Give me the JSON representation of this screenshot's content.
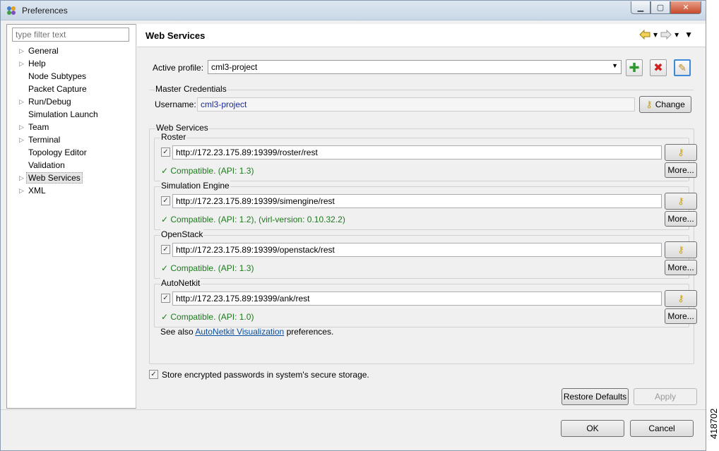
{
  "window": {
    "title": "Preferences"
  },
  "filter": {
    "placeholder": "type filter text"
  },
  "tree": [
    {
      "label": "General",
      "arrow": true
    },
    {
      "label": "Help",
      "arrow": true
    },
    {
      "label": "Node Subtypes",
      "arrow": false
    },
    {
      "label": "Packet Capture",
      "arrow": false
    },
    {
      "label": "Run/Debug",
      "arrow": true
    },
    {
      "label": "Simulation Launch",
      "arrow": false
    },
    {
      "label": "Team",
      "arrow": true
    },
    {
      "label": "Terminal",
      "arrow": true
    },
    {
      "label": "Topology Editor",
      "arrow": false
    },
    {
      "label": "Validation",
      "arrow": false
    },
    {
      "label": "Web Services",
      "arrow": true,
      "selected": true
    },
    {
      "label": "XML",
      "arrow": true
    }
  ],
  "page": {
    "title": "Web Services"
  },
  "profile": {
    "label": "Active profile:",
    "value": "cml3-project"
  },
  "credentials": {
    "legend": "Master Credentials",
    "username_label": "Username:",
    "username": "cml3-project",
    "change_label": "Change"
  },
  "web_services": {
    "legend": "Web Services",
    "services": [
      {
        "name": "Roster",
        "url": "http://172.23.175.89:19399/roster/rest",
        "status": "✓ Compatible. (API: 1.3)",
        "more": "More..."
      },
      {
        "name": "Simulation Engine",
        "url": "http://172.23.175.89:19399/simengine/rest",
        "status": "✓ Compatible. (API: 1.2), (virl-version: 0.10.32.2)",
        "more": "More..."
      },
      {
        "name": "OpenStack",
        "url": "http://172.23.175.89:19399/openstack/rest",
        "status": "✓ Compatible. (API: 1.3)",
        "more": "More..."
      },
      {
        "name": "AutoNetkit",
        "url": "http://172.23.175.89:19399/ank/rest",
        "status": "✓ Compatible. (API: 1.0)",
        "more": "More..."
      }
    ],
    "see_also_prefix": "See also",
    "see_also_link": "AutoNetkit Visualization",
    "see_also_suffix": "preferences."
  },
  "store_checkbox": {
    "label": "Store encrypted passwords in system's secure storage."
  },
  "buttons": {
    "restore_defaults": "Restore Defaults",
    "apply": "Apply",
    "ok": "OK",
    "cancel": "Cancel"
  },
  "side_code": "418702"
}
